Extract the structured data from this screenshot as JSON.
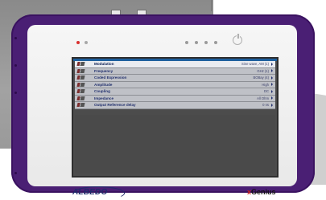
{
  "menu": {
    "rows": [
      {
        "label": "Modulation",
        "value": "Sine wave, AM (1)"
      },
      {
        "label": "Frequency",
        "value": "GHz (1)"
      },
      {
        "label": "Coded Expression",
        "value": "BOBay (4)"
      },
      {
        "label": "Amplitude",
        "value": "High"
      },
      {
        "label": "Coupling",
        "value": "DC"
      },
      {
        "label": "Impedance",
        "value": "All Ohm"
      },
      {
        "label": "Output Reference delay",
        "value": "0 ns"
      }
    ],
    "selected_index": 0
  },
  "branding": {
    "maker": "ALBEDO",
    "product_x": "x",
    "product_rest": "Genius"
  },
  "colors": {
    "device_body": "#4a1f74",
    "screen_bg": "#4c4c4c",
    "row_bg": "#bfc1c7",
    "row_selected_bg": "#e9ebf0",
    "label_text": "#22306e"
  }
}
